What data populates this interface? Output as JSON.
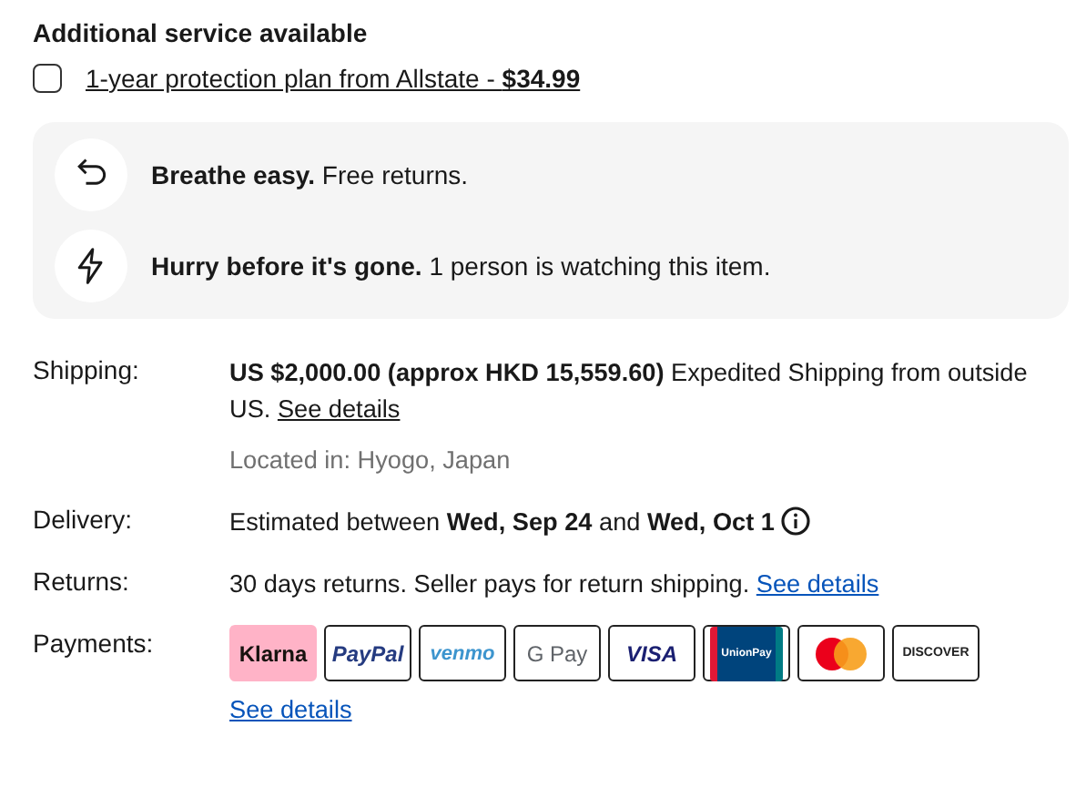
{
  "addon": {
    "title": "Additional service available",
    "option": {
      "checked": false,
      "label": "1-year protection plan from Allstate - **$34.99**"
    }
  },
  "highlights": [
    {
      "kind": "returns",
      "lead": "Breathe easy.",
      "text": "Free returns."
    },
    {
      "kind": "watchers",
      "lead": "Hurry before it's gone.",
      "text": "1 person is watching this item."
    }
  ],
  "details": [
    {
      "kind": "shipping",
      "label": "Shipping:",
      "text": "**US $2,000.00 (approx HKD 15,559.60)** Expedited Shipping from outside US.",
      "link": "See details",
      "note": "Located in: Hyogo, Japan"
    },
    {
      "kind": "delivery",
      "label": "Delivery:",
      "text": "Estimated between **Wed, Sep 24** and **Wed, Oct 1**",
      "info": true
    },
    {
      "kind": "returns",
      "label": "Returns:",
      "text": "30 days returns. Seller pays for return shipping.",
      "link": "See details"
    },
    {
      "kind": "payments",
      "label": "Payments:",
      "methods": [
        {
          "kind": "klarna",
          "label": "Klarna"
        },
        {
          "kind": "paypal",
          "label": "PayPal"
        },
        {
          "kind": "venmo",
          "label": "venmo"
        },
        {
          "kind": "gpay",
          "label": "G Pay"
        },
        {
          "kind": "visa",
          "label": "VISA"
        },
        {
          "kind": "unionpay",
          "label": "UnionPay"
        },
        {
          "kind": "mastercard"
        },
        {
          "kind": "discover",
          "label": "DISCOVER"
        }
      ],
      "link": "See details"
    }
  ]
}
